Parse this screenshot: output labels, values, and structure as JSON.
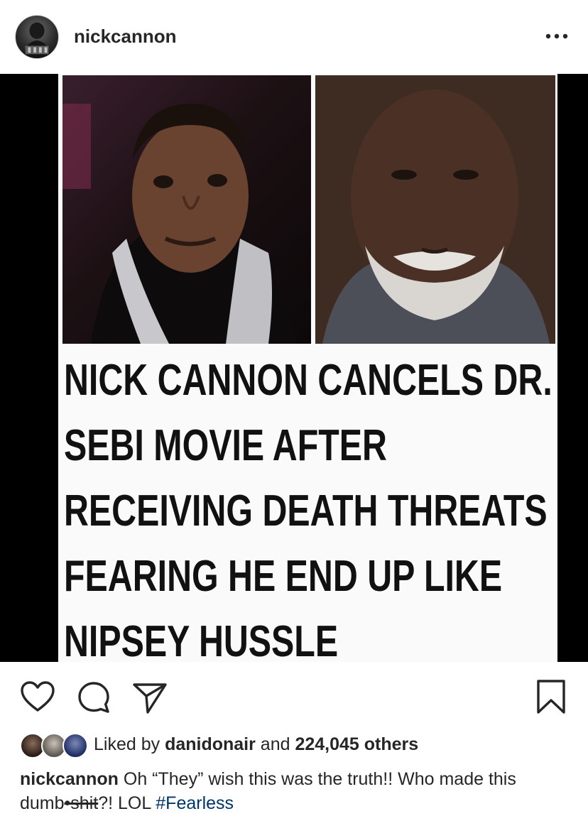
{
  "header": {
    "username": "nickcannon",
    "more_icon": "more-horizontal-icon"
  },
  "post": {
    "headline_lines": [
      "NICK CANNON CANCELS DR.",
      "SEBI MOVIE AFTER",
      "RECEIVING DEATH THREATS",
      "FEARING HE END UP LIKE",
      "NIPSEY HUSSLE"
    ]
  },
  "actions": {
    "like_icon": "heart-icon",
    "comment_icon": "comment-icon",
    "share_icon": "direct-share-icon",
    "save_icon": "bookmark-icon"
  },
  "likes": {
    "prefix": "Liked by ",
    "liked_by_user": "danidonair",
    "middle": " and ",
    "others_count": "224,045 others"
  },
  "caption": {
    "username": "nickcannon",
    "text_before_strike": " Oh “They” wish this was the truth!! Who made this dumb",
    "struck_text": "•shit",
    "text_after_strike": "?! LOL ",
    "hashtag": "#Fearless"
  },
  "colors": {
    "text": "#262626",
    "hashtag": "#003569",
    "image_border": "#000000"
  }
}
